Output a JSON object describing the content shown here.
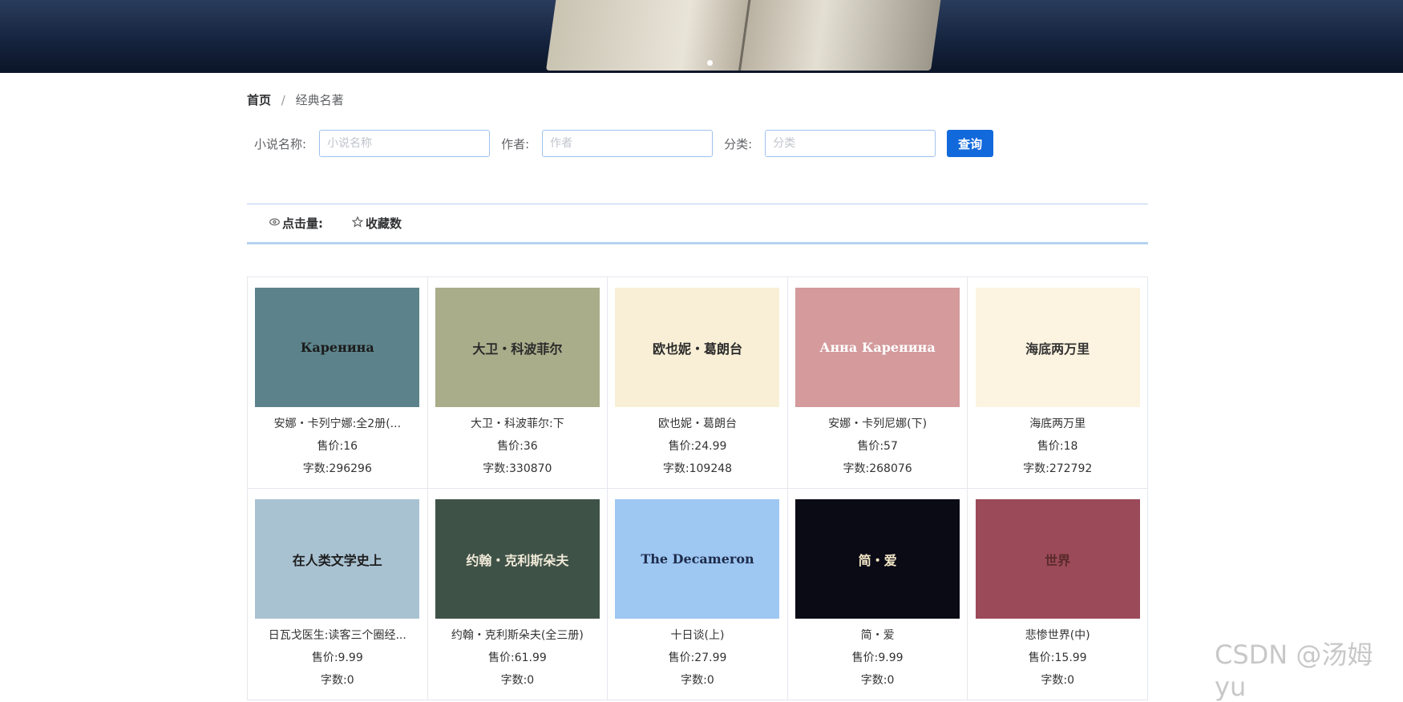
{
  "breadcrumb": {
    "home": "首页",
    "separator": "/",
    "current": "经典名著"
  },
  "search": {
    "name_label": "小说名称:",
    "name_placeholder": "小说名称",
    "author_label": "作者:",
    "author_placeholder": "作者",
    "category_label": "分类:",
    "category_placeholder": "分类",
    "query_label": "查询"
  },
  "sort": {
    "clicks_label": "点击量:",
    "favorites_label": "收藏数"
  },
  "books": [
    {
      "name": "安娜・卡列宁娜:全2册(...",
      "price": "售价:16",
      "words": "字数:296296",
      "cover_title": "Каренина",
      "cover_bg": "#5c838b",
      "cover_fg": "#1b1b1b"
    },
    {
      "name": "大卫・科波菲尔:下",
      "price": "售价:36",
      "words": "字数:330870",
      "cover_title": "大卫・科波菲尔",
      "cover_bg": "#a9ad8a",
      "cover_fg": "#2a2a2a"
    },
    {
      "name": "欧也妮・葛朗台",
      "price": "售价:24.99",
      "words": "字数:109248",
      "cover_title": "欧也妮・葛朗台",
      "cover_bg": "#f8efd6",
      "cover_fg": "#2a2a2a"
    },
    {
      "name": "安娜・卡列尼娜(下)",
      "price": "售价:57",
      "words": "字数:268076",
      "cover_title": "Анна Каренина",
      "cover_bg": "#d49a9c",
      "cover_fg": "#ffffff"
    },
    {
      "name": "海底两万里",
      "price": "售价:18",
      "words": "字数:272792",
      "cover_title": "海底两万里",
      "cover_bg": "#fcf4e0",
      "cover_fg": "#333333"
    },
    {
      "name": "日瓦戈医生:读客三个圈经...",
      "price": "售价:9.99",
      "words": "字数:0",
      "cover_title": "在人类文学史上",
      "cover_bg": "#a9c2d2",
      "cover_fg": "#1d1d1d"
    },
    {
      "name": "约翰・克利斯朵夫(全三册)",
      "price": "售价:61.99",
      "words": "字数:0",
      "cover_title": "约翰・克利斯朵夫",
      "cover_bg": "#3f5248",
      "cover_fg": "#f0ead8"
    },
    {
      "name": "十日谈(上)",
      "price": "售价:27.99",
      "words": "字数:0",
      "cover_title": "The Decameron",
      "cover_bg": "#9ec7f2",
      "cover_fg": "#1d2b4a"
    },
    {
      "name": "简・爱",
      "price": "售价:9.99",
      "words": "字数:0",
      "cover_title": "简・爱",
      "cover_bg": "#0b0b16",
      "cover_fg": "#f2e6c6"
    },
    {
      "name": "悲惨世界(中)",
      "price": "售价:15.99",
      "words": "字数:0",
      "cover_title": "世界",
      "cover_bg": "#9b4a59",
      "cover_fg": "#5a2a2a"
    }
  ],
  "watermark": "CSDN @汤姆yu"
}
